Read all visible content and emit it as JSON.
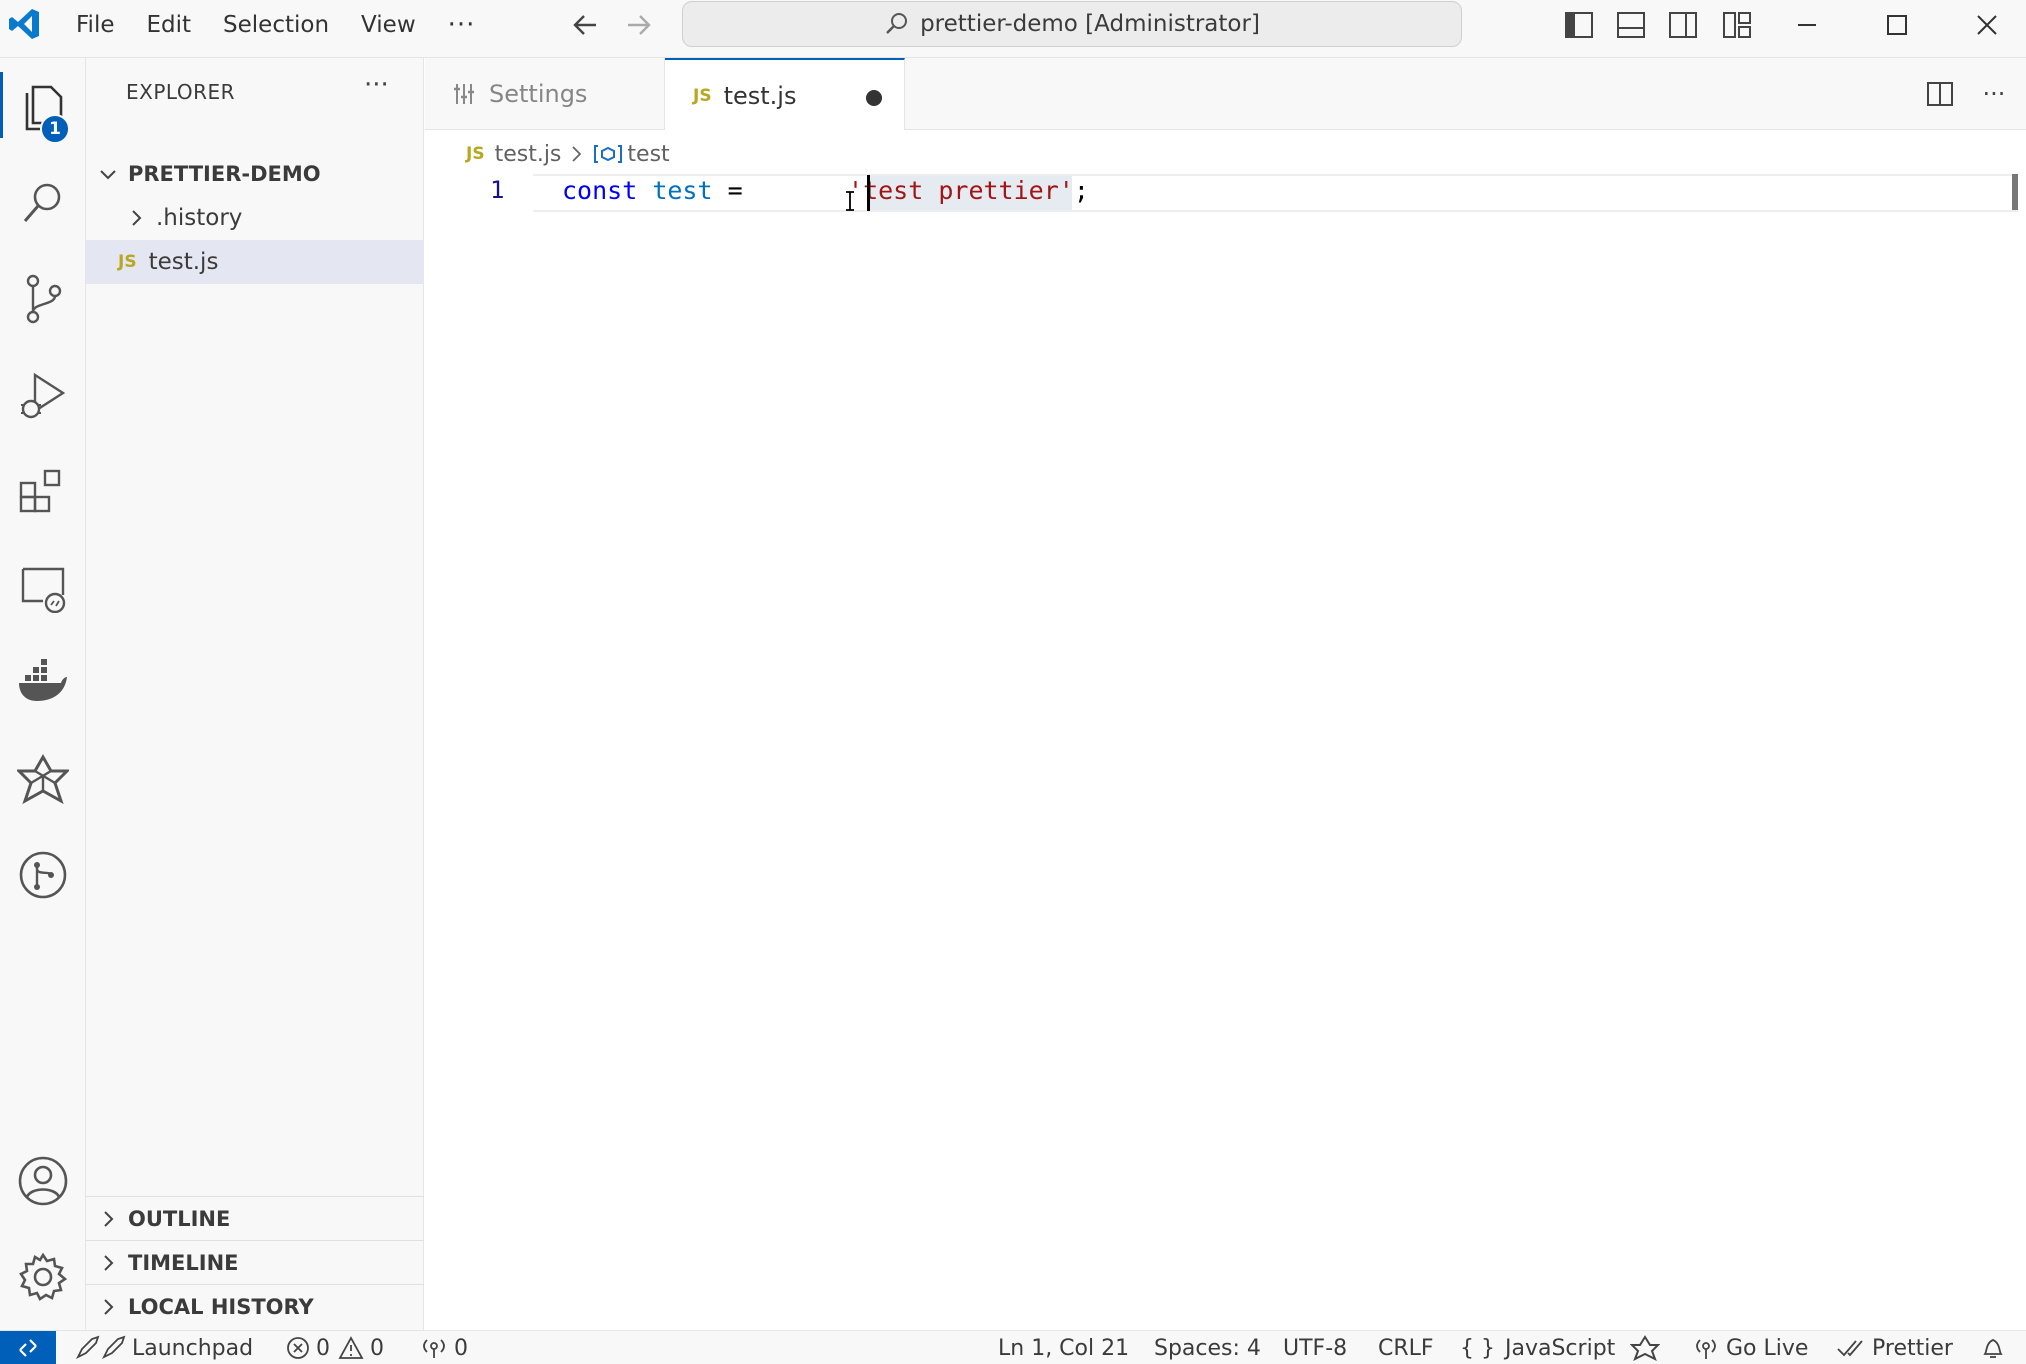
{
  "titlebar": {
    "menu": [
      "File",
      "Edit",
      "Selection",
      "View"
    ],
    "more": "···",
    "command_center": "prettier-demo [Administrator]"
  },
  "activitybar": {
    "explorer_badge": "1"
  },
  "sidebar": {
    "title": "EXPLORER",
    "more": "···",
    "folder": "PRETTIER-DEMO",
    "items": [
      {
        "label": ".history"
      },
      {
        "label": "test.js",
        "icon": "JS"
      }
    ],
    "panels": [
      "OUTLINE",
      "TIMELINE",
      "LOCAL HISTORY"
    ]
  },
  "tabs": [
    {
      "label": "Settings"
    },
    {
      "label": "test.js",
      "icon": "JS",
      "dirty": true
    }
  ],
  "breadcrumbs": {
    "file": "test.js",
    "file_icon": "JS",
    "symbol": "test"
  },
  "editor": {
    "line_number": "1",
    "code": {
      "keyword": "const",
      "identifier": "test",
      "operator": "=",
      "string": "'test prettier'",
      "terminator": ";"
    }
  },
  "statusbar": {
    "launchpad": "Launchpad",
    "errors": "0",
    "warnings": "0",
    "ports": "0",
    "position": "Ln 1, Col 21",
    "spaces": "Spaces: 4",
    "encoding": "UTF-8",
    "eol": "CRLF",
    "language_braces": "{ }",
    "language": "JavaScript",
    "golive": "Go Live",
    "prettier": "Prettier"
  },
  "colors": {
    "accent": "#005fb8",
    "keyword": "#0000ff",
    "identifier": "#0070c1",
    "string": "#a31515"
  }
}
